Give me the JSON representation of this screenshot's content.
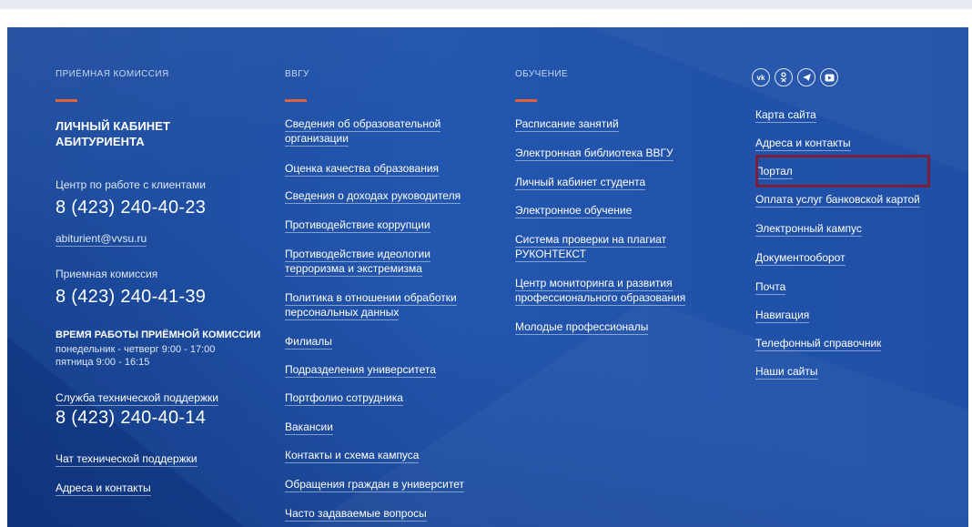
{
  "admission": {
    "heading": "ПРИЁМНАЯ КОМИССИЯ",
    "cabinet_line1": "ЛИЧНЫЙ КАБИНЕТ",
    "cabinet_line2": "АБИТУРИЕНТА",
    "client_center_label": "Центр по работе с клиентами",
    "client_center_phone": "8 (423) 240-40-23",
    "email": "abiturient@vvsu.ru",
    "commission_label": "Приемная комиссия",
    "commission_phone": "8 (423) 240-41-39",
    "hours_title": "ВРЕМЯ РАБОТЫ ПРИЁМНОЙ КОМИССИИ",
    "hours_line1": "понедельник - четверг 9:00 - 17:00",
    "hours_line2": "пятница 9:00 - 16:15",
    "support_link": "Служба технической поддержки",
    "support_phone": "8 (423) 240-40-14",
    "chat_link": "Чат технической поддержки",
    "addresses_link": "Адреса и контакты"
  },
  "vvgu": {
    "heading": "ВВГУ",
    "links": [
      "Сведения об образовательной",
      "организации",
      "Оценка качества образования",
      "Сведения о доходах руководителя",
      "Противодействие коррупции",
      "Противодействие идеологии",
      "терроризма и экстремизма",
      "Политика в отношении обработки",
      "персональных данных",
      "Филиалы",
      "Подразделения университета",
      "Портфолио сотрудника",
      "Вакансии",
      "Контакты и схема кампуса",
      "Обращения граждан в университет",
      "Часто задаваемые вопросы"
    ]
  },
  "education": {
    "heading": "ОБУЧЕНИЕ",
    "links": [
      "Расписание занятий",
      "Электронная библиотека ВВГУ",
      "Личный кабинет студента",
      "Электронное обучение",
      "Система проверки на плагиат",
      "РУКОНТЕКСТ",
      "Центр мониторинга и развития",
      "профессионального образования",
      "Молодые профессионалы"
    ]
  },
  "services": {
    "social_icons": [
      "vk-icon",
      "odnoklassniki-icon",
      "telegram-icon",
      "rutube-icon"
    ],
    "social_vk_text": "vk",
    "links": [
      "Карта сайта",
      "Адреса и контакты",
      "Портал",
      "Оплата услуг банковской картой",
      "Электронный кампус",
      "Документооборот",
      "Почта",
      "Навигация",
      "Телефонный справочник",
      "Наши сайты"
    ]
  },
  "colors": {
    "background": "#1f4fa0",
    "accent": "#e0603a",
    "highlight_box": "#7b1f3a"
  }
}
